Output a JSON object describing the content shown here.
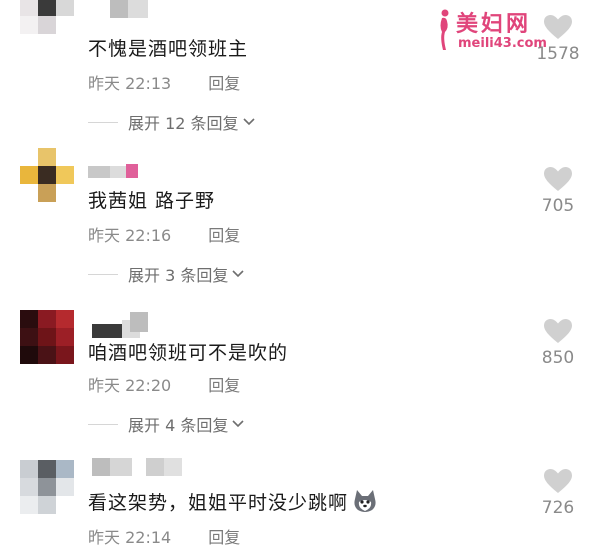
{
  "watermark": {
    "title": "美妇网",
    "url": "meili43.com"
  },
  "comments": [
    {
      "text": "不愧是酒吧领班主",
      "time": "昨天 22:13",
      "reply": "回复",
      "expand": "展开 12 条回复",
      "likes": "1578"
    },
    {
      "text": "我茜姐 路子野",
      "time": "昨天 22:16",
      "reply": "回复",
      "expand": "展开 3 条回复",
      "likes": "705"
    },
    {
      "text": "咱酒吧领班可不是吹的",
      "time": "昨天 22:20",
      "reply": "回复",
      "expand": "展开 4 条回复",
      "likes": "850"
    },
    {
      "text": "看这架势，姐姐平时没少跳啊",
      "time": "昨天 22:14",
      "reply": "回复",
      "likes": "726"
    }
  ],
  "icons": {
    "like": "heart-icon",
    "expand": "chevron-down-icon",
    "emoji": "husky-dog-emoji-icon"
  },
  "colors": {
    "heart": "#d0d0d0",
    "watermark": "#e0457b",
    "meta": "#8a8a8a"
  }
}
